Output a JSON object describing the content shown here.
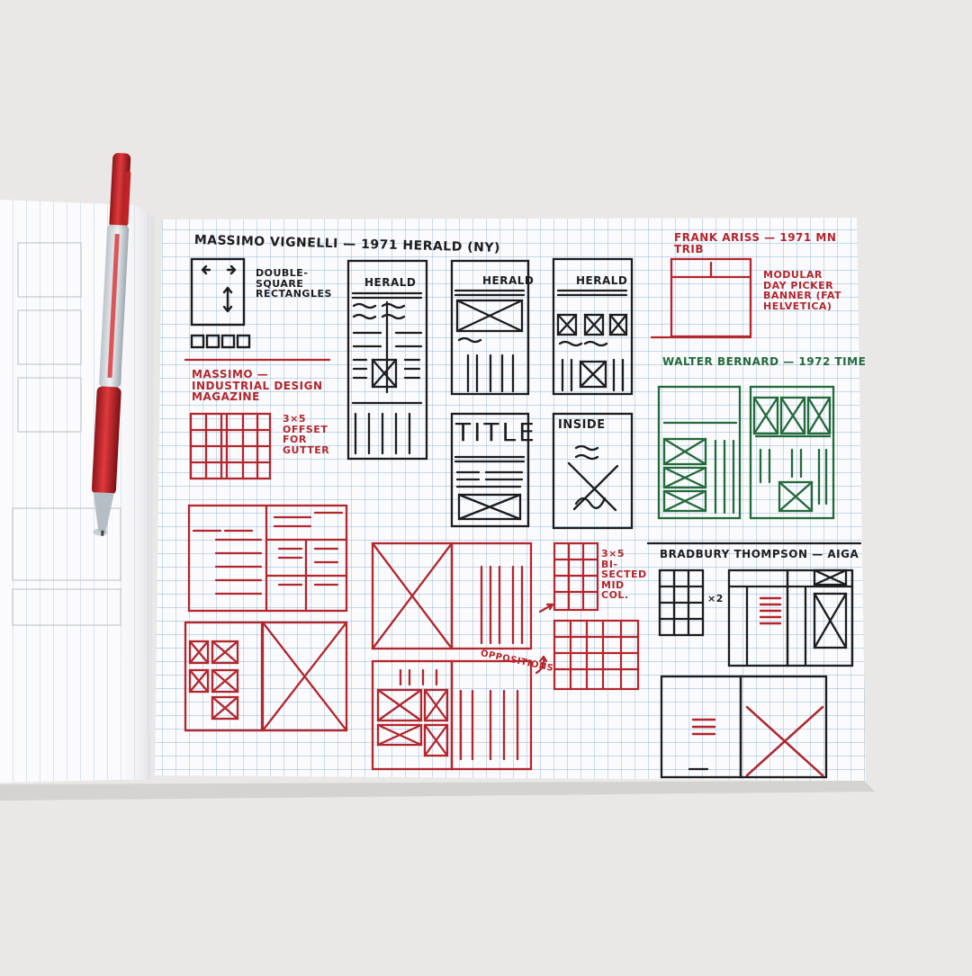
{
  "photo": {
    "background_color": "#e9e8e6",
    "paper_color": "#fbfbfd",
    "grid_color": "#8fb3d6",
    "ink_colors": {
      "black": "#1d1d1f",
      "red": "#b3262c",
      "green": "#236a3a"
    },
    "pen": {
      "barrel": "clear",
      "grip": "red",
      "cap": "red"
    }
  },
  "notes": {
    "vignelli_herald": "MASSIMO VIGNELLI — 1971 Herald (NY)",
    "double_square": "DOUBLE-SQUARE RECTANGLES",
    "massimo_industrial": "MASSIMO — INDUSTRIAL DESIGN MAGAZINE",
    "offset_gutter": "3×5 OFFSET FOR GUTTER",
    "frank_ariss": "FRANK ARISS — 1971 MN TRIB",
    "modular_banner": "MODULAR DAY PICKER BANNER (FAT HELVETICA)",
    "walter_bernard": "WALTER BERNARD — 1972 TIME",
    "title_sketch": "TITLE",
    "inside_sketch": "INSIDE",
    "bisected": "3×5 BI-SECTED MID COL.",
    "oppositions": "OPPOSITIONS",
    "bradbury": "BRADBURY THOMPSON — AIGA",
    "times_two": "×2",
    "herald_masthead": "HERALD",
    "herald_masthead_2": "HERALD",
    "herald_masthead_3": "HERALD"
  }
}
